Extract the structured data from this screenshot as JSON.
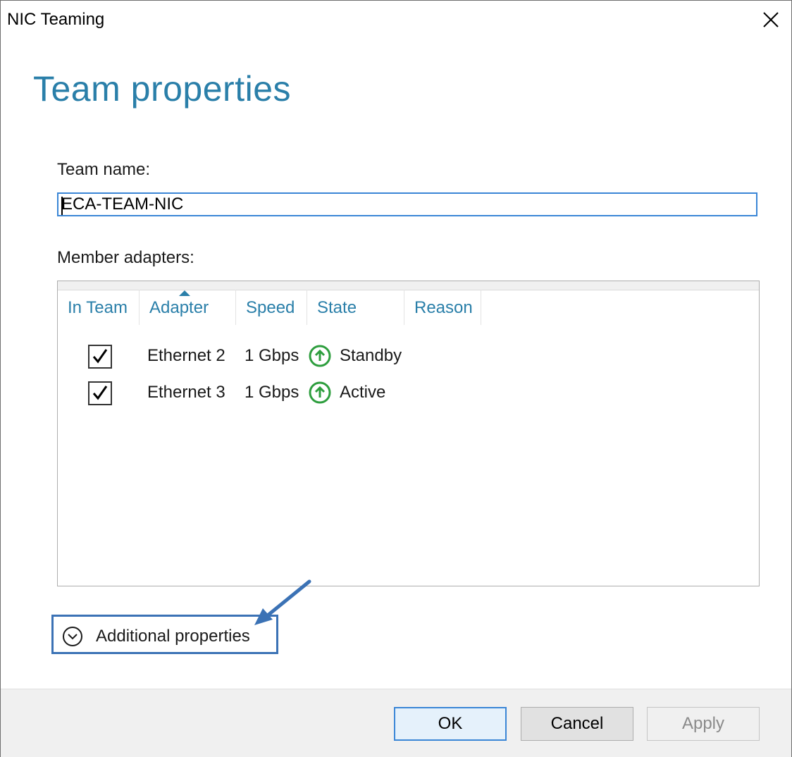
{
  "window": {
    "title": "NIC Teaming"
  },
  "page": {
    "title": "Team properties"
  },
  "team_name": {
    "label": "Team name:",
    "value": "ECA-TEAM-NIC"
  },
  "members": {
    "label": "Member adapters:",
    "columns": [
      "In Team",
      "Adapter",
      "Speed",
      "State",
      "Reason"
    ],
    "sort_column": "Adapter",
    "rows": [
      {
        "in_team": true,
        "adapter": "Ethernet 2",
        "speed": "1 Gbps",
        "state": "Standby",
        "state_icon": "up-arrow-circle-icon",
        "reason": ""
      },
      {
        "in_team": true,
        "adapter": "Ethernet 3",
        "speed": "1 Gbps",
        "state": "Active",
        "state_icon": "up-arrow-circle-icon",
        "reason": ""
      }
    ]
  },
  "additional_properties": {
    "label": "Additional properties",
    "icon": "chevron-down-circle-icon",
    "expanded": false
  },
  "buttons": {
    "ok": "OK",
    "cancel": "Cancel",
    "apply": "Apply",
    "apply_enabled": false
  },
  "colors": {
    "accent": "#2a7fa9",
    "focus": "#3a86d6",
    "status_ok": "#2e9e3e",
    "annotation": "#3b72b5"
  }
}
